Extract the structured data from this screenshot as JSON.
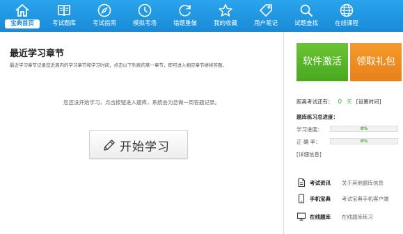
{
  "nav": {
    "items": [
      {
        "label": "宝典首页",
        "icon": "home-icon"
      },
      {
        "label": "考试题库",
        "icon": "book-icon"
      },
      {
        "label": "考试指南",
        "icon": "compass-icon"
      },
      {
        "label": "模拟考场",
        "icon": "clock-icon"
      },
      {
        "label": "错题重做",
        "icon": "refresh-icon"
      },
      {
        "label": "我的收藏",
        "icon": "star-icon"
      },
      {
        "label": "用户笔记",
        "icon": "tag-icon"
      },
      {
        "label": "试题查找",
        "icon": "search-icon"
      },
      {
        "label": "在线课程",
        "icon": "globe-icon"
      }
    ],
    "active_index": 0
  },
  "main": {
    "title": "最近学习章节",
    "description": "最近学习章节记录您近周内的学习章节和学习时间，点击以下列表的某一章节，即可进入相应章节继续答题。",
    "empty_message": "您还没开始学习，点击按钮进入题库，系统会为您做一周答题记录。",
    "start_button": "开始学习"
  },
  "sidebar": {
    "activate_button": "软件激活",
    "gift_button": "领取礼包",
    "exam_countdown": {
      "label": "距离考试还有：",
      "days": "0",
      "unit": "天",
      "set_link": "[设置时间]"
    },
    "progress_title": "题库练习总进度：",
    "study_progress": {
      "label": "学习进度：",
      "value": "0%",
      "fraction": 0
    },
    "accuracy": {
      "label": "正 确 率：",
      "value": "0%",
      "fraction": 0
    },
    "detail_link": "[详细信息]",
    "info": [
      {
        "title": "考试资讯",
        "desc": "关于其他题库信息",
        "icon": "document-icon"
      },
      {
        "title": "手机宝典",
        "desc": "考试宝典手机客户端",
        "icon": "phone-icon"
      },
      {
        "title": "在线题库",
        "desc": "在线题库练习",
        "icon": "monitor-icon"
      }
    ]
  },
  "colors": {
    "nav_blue": "#1a8ad7",
    "activate_green": "#48a81e",
    "gift_orange": "#e8801a",
    "days_green": "#3bb33b"
  }
}
